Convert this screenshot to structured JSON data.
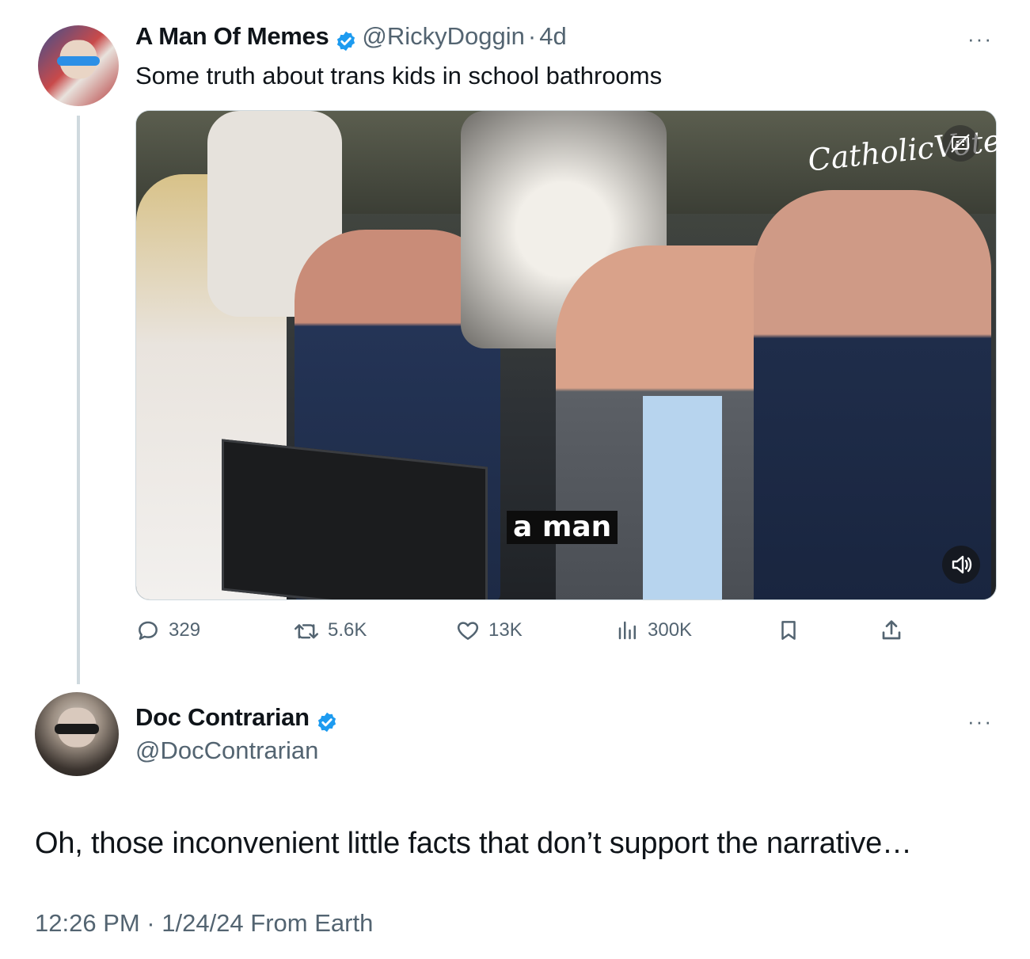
{
  "original_tweet": {
    "author_name": "A Man Of Memes",
    "author_handle": "@RickyDoggin",
    "time_ago": "4d",
    "separator": "·",
    "text": "Some truth about trans kids in school bathrooms",
    "more": "···",
    "media": {
      "caption": "a man",
      "watermark": "CatholicVote",
      "cc_icon": "closed-captions-icon",
      "mute_icon": "speaker-icon"
    },
    "actions": {
      "replies": "329",
      "retweets": "5.6K",
      "likes": "13K",
      "views": "300K"
    }
  },
  "reply_tweet": {
    "author_name": "Doc Contrarian",
    "author_handle": "@DocContrarian",
    "more": "···",
    "text": "Oh, those inconvenient little facts that don’t support the narrative…",
    "timestamp": "12:26 PM · 1/24/24 From Earth"
  },
  "colors": {
    "text": "#0f1419",
    "secondary": "#536471",
    "verified": "#1d9bf0",
    "thread_line": "#cfd9de"
  }
}
